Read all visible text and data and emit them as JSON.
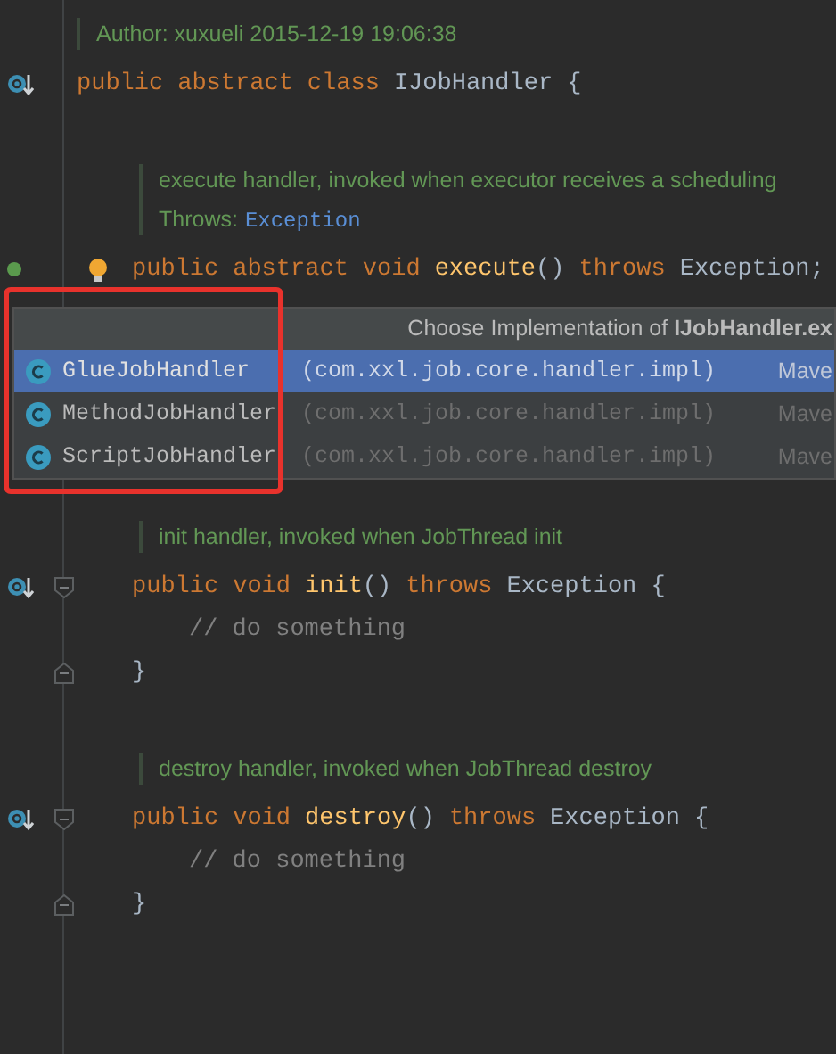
{
  "editor": {
    "lines": [
      {
        "kind": "class_doc",
        "rows": [
          [
            {
              "text": "Author: xuxueli 2015-12-19 19:06:38",
              "link": false
            }
          ]
        ]
      },
      {
        "kind": "class_code",
        "override_marker": true,
        "tokens": [
          {
            "text": "public",
            "kind": "keyword"
          },
          {
            "text": "abstract",
            "kind": "keyword"
          },
          {
            "text": "class",
            "kind": "keyword"
          },
          {
            "text": "IJobHandler {",
            "kind": "plain"
          }
        ]
      },
      {
        "kind": "blank"
      },
      {
        "kind": "member_doc",
        "rows": [
          [
            {
              "text": "execute handler, invoked when executor receives a scheduling",
              "link": false
            }
          ],
          [
            {
              "text": "Throws:",
              "link": false
            },
            {
              "text": "Exception",
              "link": true
            }
          ]
        ]
      },
      {
        "kind": "member_code",
        "implemented_marker": true,
        "bulb": true,
        "tokens": [
          {
            "text": "public",
            "kind": "keyword"
          },
          {
            "text": "abstract",
            "kind": "keyword"
          },
          {
            "text": "void",
            "kind": "keyword"
          },
          {
            "text": "execute",
            "kind": "method"
          },
          {
            "text": "()",
            "kind": "plain"
          },
          {
            "text": "throws",
            "kind": "keyword"
          },
          {
            "text": "Exception;",
            "kind": "plain"
          }
        ]
      },
      {
        "kind": "blank"
      },
      {
        "kind": "blank"
      },
      {
        "kind": "blank"
      },
      {
        "kind": "blank"
      },
      {
        "kind": "blank"
      },
      {
        "kind": "member_doc",
        "rows": [
          [
            {
              "text": "init handler, invoked when JobThread init",
              "link": false
            }
          ]
        ]
      },
      {
        "kind": "member_code",
        "override_marker": true,
        "fold_open": true,
        "tokens": [
          {
            "text": "public",
            "kind": "keyword"
          },
          {
            "text": "void",
            "kind": "keyword"
          },
          {
            "text": "init",
            "kind": "method"
          },
          {
            "text": "()",
            "kind": "plain"
          },
          {
            "text": "throws",
            "kind": "keyword"
          },
          {
            "text": "Exception {",
            "kind": "plain"
          }
        ]
      },
      {
        "kind": "body_code",
        "tokens": [
          {
            "text": "// do something",
            "kind": "comment"
          }
        ]
      },
      {
        "kind": "member_code",
        "fold_close": true,
        "tokens": [
          {
            "text": "}",
            "kind": "plain"
          }
        ]
      },
      {
        "kind": "blank"
      },
      {
        "kind": "member_doc",
        "rows": [
          [
            {
              "text": "destroy handler, invoked when JobThread destroy",
              "link": false
            }
          ]
        ]
      },
      {
        "kind": "member_code",
        "override_marker": true,
        "fold_open": true,
        "tokens": [
          {
            "text": "public",
            "kind": "keyword"
          },
          {
            "text": "void",
            "kind": "keyword"
          },
          {
            "text": "destroy",
            "kind": "method"
          },
          {
            "text": "()",
            "kind": "plain"
          },
          {
            "text": "throws",
            "kind": "keyword"
          },
          {
            "text": "Exception {",
            "kind": "plain"
          }
        ]
      },
      {
        "kind": "body_code",
        "tokens": [
          {
            "text": "// do something",
            "kind": "comment"
          }
        ]
      },
      {
        "kind": "member_code",
        "fold_close": true,
        "tokens": [
          {
            "text": "}",
            "kind": "plain"
          }
        ]
      }
    ]
  },
  "popup": {
    "title": "Choose Implementation of **IJobHandler.ex**",
    "highlighted": true,
    "items": [
      {
        "name": "GlueJobHandler",
        "package": "(com.xxl.job.core.handler.impl)",
        "source": "Mave",
        "selected": true
      },
      {
        "name": "MethodJobHandler",
        "package": "(com.xxl.job.core.handler.impl)",
        "source": "Mave",
        "selected": false
      },
      {
        "name": "ScriptJobHandler",
        "package": "(com.xxl.job.core.handler.impl)",
        "source": "Mave",
        "selected": false
      }
    ]
  }
}
